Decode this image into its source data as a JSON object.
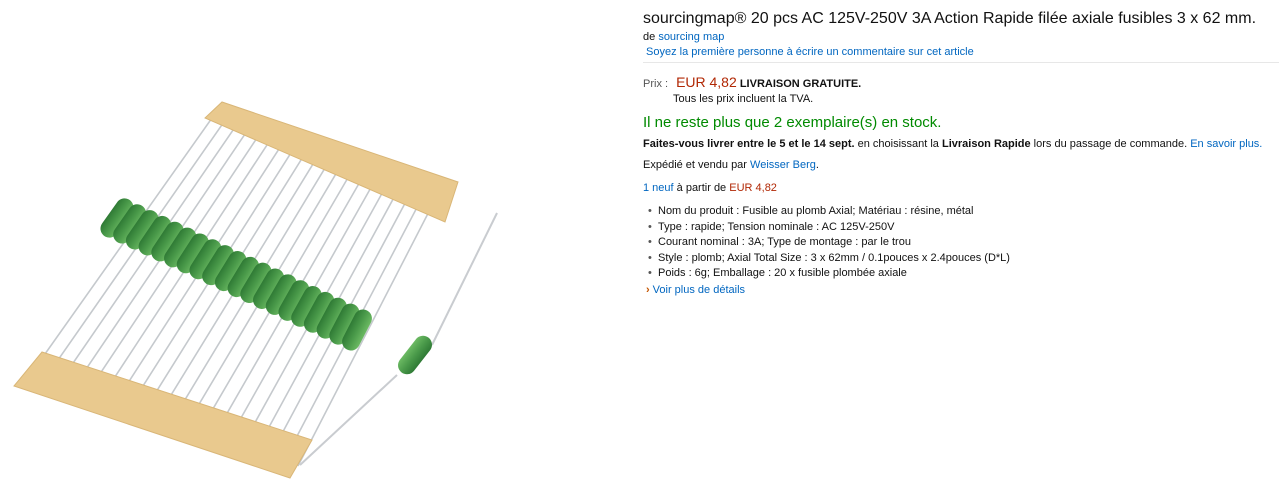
{
  "product": {
    "title": "sourcingmap® 20 pcs AC 125V-250V 3A Action Rapide filée axiale fusibles 3 x 62 mm.",
    "byline_prefix": "de",
    "brand": "sourcing map",
    "review_link": "Soyez la première personne à écrire un commentaire sur cet article",
    "image_alt": "axial fuses on tape"
  },
  "price": {
    "label": "Prix :",
    "value": "EUR 4,82",
    "shipping": "LIVRAISON GRATUITE.",
    "vat_note": "Tous les prix incluent la TVA."
  },
  "availability": {
    "stock": "Il ne reste plus que 2 exemplaire(s) en stock."
  },
  "delivery": {
    "dates": "Faites-vous livrer entre le 5 et le 14 sept.",
    "mid": " en choisissant la ",
    "method": "Livraison Rapide",
    "end": " lors du passage de commande. ",
    "learn_more": "En savoir plus."
  },
  "seller": {
    "prefix": "Expédié et vendu par ",
    "name": "Weisser Berg",
    "suffix": "."
  },
  "offers": {
    "link": "1 neuf",
    "mid": " à partir de ",
    "price": "EUR 4,82"
  },
  "features": [
    "Nom du produit : Fusible au plomb Axial; Matériau : résine, métal",
    "Type : rapide; Tension nominale : AC 125V-250V",
    "Courant nominal : 3A; Type de montage : par le trou",
    "Style : plomb; Axial Total Size : 3 x 62mm / 0.1pouces x 2.4pouces (D*L)",
    "Poids : 6g; Emballage  : 20 x fusible plombée axiale"
  ],
  "more_details": "Voir plus de détails",
  "icons": {
    "bullet": "•",
    "chevron": "›"
  },
  "colors": {
    "link": "#0066c0",
    "price": "#b12704",
    "stock": "#008a00",
    "fuse_body": "#4a9a4a",
    "tape": "#e9c98e"
  }
}
